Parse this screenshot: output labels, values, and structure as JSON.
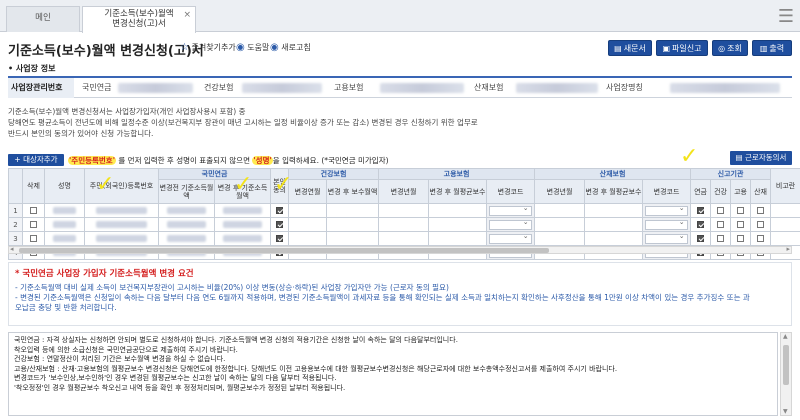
{
  "tabs": {
    "home": "메인",
    "active_line1": "기준소득(보수)월액",
    "active_line2": "변경신청(고)서",
    "close": "×",
    "menu_icon": "hamburger-icon"
  },
  "header": {
    "title": "기준소득(보수)월액 변경신청(고)서",
    "favorite": "즐겨찾기추가",
    "help": "도움말",
    "refresh": "새로고침",
    "buttons": {
      "new_doc": "새문서",
      "file_report": "파일신고",
      "search": "조회",
      "print": "출력"
    }
  },
  "workplace": {
    "section_title": "사업장 정보",
    "mgmt_no_label": "사업장관리번호",
    "pension_label": "국민연금",
    "health_label": "건강보험",
    "employment_label": "고용보험",
    "accident_label": "산재보험",
    "name_label": "사업장명칭"
  },
  "description": {
    "line1": "기준소득(보수)월액 변경신청서는 사업장가입자(개인 사업장사용시 포함) 중",
    "line2": "당해연도 평균소득이 전년도에 비해 일정수준 이상(보건복지부 장관이 매년 고시하는 일정 비율이상 증가 또는 감소) 변경된 경우 신청하기 위한 업무로",
    "line3": "반드시 본인의 동의가 있어야 신청 가능합니다."
  },
  "notebar": {
    "add_button": "+ 대상자추가",
    "note_pre": "'주민등록번호'",
    "note_mid": " 를 먼저 입력한 후 성명이 표출되지 않으면 ",
    "note_name": "'성명'",
    "note_post": "을 입력하세요. (*국민연금 미가입자)",
    "work_consent_button": "근로자동의서"
  },
  "table": {
    "headers": {
      "delete": "삭제",
      "name": "성명",
      "rrn": "주민(외국인)등록번호",
      "pension_group": "국민연금",
      "pension_before": "변경전 기준소득월액",
      "pension_after": "변경 후 기준소득월액",
      "consent": "본인 동의",
      "health_group": "건강보험",
      "health_ym": "변경연월",
      "health_after": "변경 후 보수월액",
      "employment_group": "고용보험",
      "emp_ym": "변경년월",
      "emp_after": "변경 후 월평균보수",
      "emp_code": "변경코드",
      "accident_group": "산재보험",
      "acc_ym": "변경년월",
      "acc_after": "변경 후 월평균보수",
      "acc_code": "변경코드",
      "report_group": "신고기관",
      "rep_pension": "연금",
      "rep_health": "건강",
      "rep_employment": "고용",
      "rep_accident": "산재",
      "note": "비고란"
    },
    "rows": [
      {
        "no": "1",
        "consent": true,
        "pension": true,
        "health": false,
        "employment": false,
        "accident": false
      },
      {
        "no": "2",
        "consent": true,
        "pension": true,
        "health": false,
        "employment": false,
        "accident": false
      },
      {
        "no": "3",
        "consent": true,
        "pension": true,
        "health": false,
        "employment": false,
        "accident": false
      },
      {
        "no": "4",
        "consent": true,
        "pension": true,
        "health": false,
        "employment": false,
        "accident": false
      }
    ]
  },
  "requirements": {
    "title": "* 국민연금 사업장 가입자 기준소득월액 변경 요건",
    "line1": "- 기준소득월액 대비 실제 소득이 보건복지부장관이 고시하는 비율(20%) 이상 변동(상승·하락)된 사업장 가입자만 가능 (근로자 동의 필요)",
    "line2": "- 변경된 기준소득월액은 신청일이 속하는 다음 달부터 다음 연도 6월까지 적용하며, 변경된 기준소득월액이 과세자료 등을 통해 확인되는 실제 소득과 일치하는지 확인하는 사후정산을 통해 1만원 이상 차액이 있는 경우 추가징수 또는 과",
    "line3": "오납금 충당 및 반환 처리합니다."
  },
  "notes": {
    "lines": [
      "국민연금 : 자격 상실자는 신청하면 안되며 별도로 신청하셔야 합니다. 기준소득월액 변경 신청의 적용기간은 신청한 날이 속하는 달의 다음달부터입니다.",
      "착오입력 등에 의한 소급신청은 국민연금공단으로 제출하여 주시기 바랍니다.",
      "건강보험 : 연말정산이 처리된 기간은 보수월액 변경을 하실 수 없습니다.",
      "고용/산재보험 : 산재·고용보험의 월평균보수 변경신청은 당해연도에 한정합니다. 당해년도 이전 고용용보수에 대한 월평균보수변경신청은 해당근로자에 대한 보수총액수정신고서를 제출하여 주시기 바랍니다.",
      "변경코드가 '보수인상,보수인하'인 경우 변경된 월평균보수는 신고한 날이 속하는 달의 다음 달부터 적용됩니다.",
      "'착오정정'인 경우 월평균보수 착오신고 내역 등을 확인 후 정정처리되며, 월평균보수가 정정된 날부터 적용됩니다."
    ]
  }
}
